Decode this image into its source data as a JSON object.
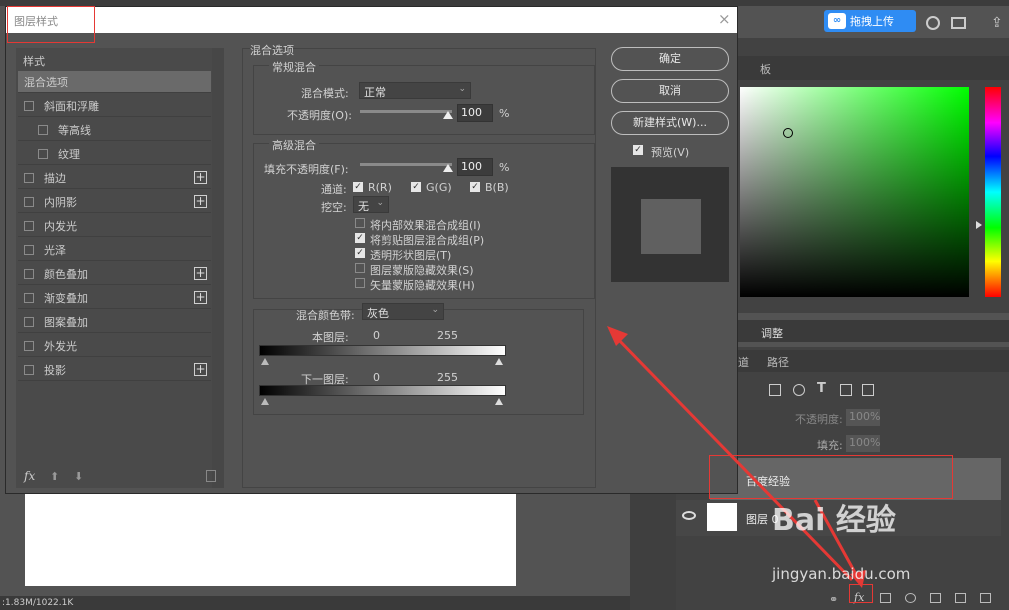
{
  "workspace": {
    "upload_button": "拖拽上传",
    "color_tab": "板",
    "adjust_tab": "调整",
    "channels_tab": "道",
    "paths_tab": "路径",
    "opacity_label": "不透明度:",
    "opacity_value": "100%",
    "fill_label": "填充:",
    "fill_value": "100%",
    "layer_baidu": "百度经验",
    "layer_0": "图层 0",
    "status": ":1.83M/1022.1K"
  },
  "dialog": {
    "title": "图层样式",
    "close_icon": "×",
    "styles_header": "样式",
    "styles": [
      {
        "label": "混合选项",
        "active": true,
        "checkbox": false,
        "plus": false,
        "indent": false
      },
      {
        "label": "斜面和浮雕",
        "active": false,
        "checkbox": true,
        "plus": false,
        "indent": false
      },
      {
        "label": "等高线",
        "active": false,
        "checkbox": true,
        "plus": false,
        "indent": true
      },
      {
        "label": "纹理",
        "active": false,
        "checkbox": true,
        "plus": false,
        "indent": true
      },
      {
        "label": "描边",
        "active": false,
        "checkbox": true,
        "plus": true,
        "indent": false
      },
      {
        "label": "内阴影",
        "active": false,
        "checkbox": true,
        "plus": true,
        "indent": false
      },
      {
        "label": "内发光",
        "active": false,
        "checkbox": true,
        "plus": false,
        "indent": false
      },
      {
        "label": "光泽",
        "active": false,
        "checkbox": true,
        "plus": false,
        "indent": false
      },
      {
        "label": "颜色叠加",
        "active": false,
        "checkbox": true,
        "plus": true,
        "indent": false
      },
      {
        "label": "渐变叠加",
        "active": false,
        "checkbox": true,
        "plus": true,
        "indent": false
      },
      {
        "label": "图案叠加",
        "active": false,
        "checkbox": true,
        "plus": false,
        "indent": false
      },
      {
        "label": "外发光",
        "active": false,
        "checkbox": true,
        "plus": false,
        "indent": false
      },
      {
        "label": "投影",
        "active": false,
        "checkbox": true,
        "plus": true,
        "indent": false
      }
    ],
    "footer_fx": "fx",
    "blend": {
      "section_title": "混合选项",
      "general_title": "常规混合",
      "blend_mode_label": "混合模式:",
      "blend_mode_value": "正常",
      "opacity_label": "不透明度(O):",
      "opacity_value": "100",
      "percent": "%",
      "advanced_title": "高级混合",
      "fill_opacity_label": "填充不透明度(F):",
      "fill_opacity_value": "100",
      "channels_label": "通道:",
      "channel_r": "R(R)",
      "channel_g": "G(G)",
      "channel_b": "B(B)",
      "knockout_label": "挖空:",
      "knockout_value": "无",
      "options": [
        {
          "label": "将内部效果混合成组(I)",
          "checked": false
        },
        {
          "label": "将剪贴图层混合成组(P)",
          "checked": true
        },
        {
          "label": "透明形状图层(T)",
          "checked": true
        },
        {
          "label": "图层蒙版隐藏效果(S)",
          "checked": false
        },
        {
          "label": "矢量蒙版隐藏效果(H)",
          "checked": false
        }
      ],
      "blend_if_label": "混合颜色带:",
      "blend_if_value": "灰色",
      "this_layer_label": "本图层:",
      "this_layer_min": "0",
      "this_layer_max": "255",
      "underlying_label": "下一图层:",
      "underlying_min": "0",
      "underlying_max": "255"
    },
    "buttons": {
      "ok": "确定",
      "cancel": "取消",
      "new_style": "新建样式(W)..."
    },
    "preview_label": "预览(V)"
  },
  "watermark": {
    "main": "Bai 经验",
    "url": "jingyan.baidu.com"
  },
  "colors": {
    "annotation_red": "#e53935",
    "upload_blue": "#2f8cf3",
    "hue_green": "#00ff00"
  }
}
